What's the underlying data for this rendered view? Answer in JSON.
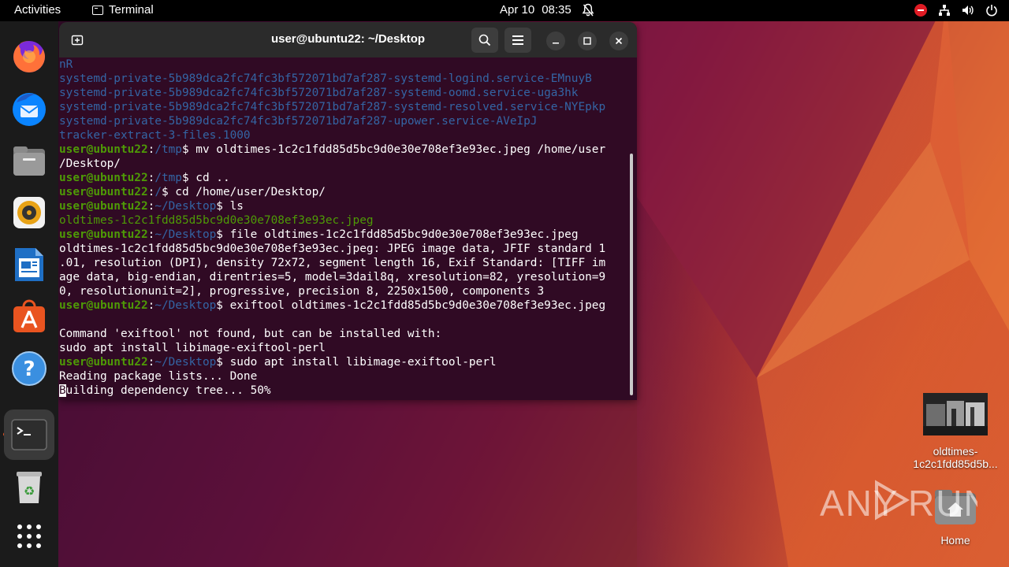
{
  "topbar": {
    "activities": "Activities",
    "app_name": "Terminal",
    "date": "Apr 10",
    "time": "08:35"
  },
  "dock": {
    "items": [
      "firefox-icon",
      "thunderbird-icon",
      "files-icon",
      "rhythmbox-icon",
      "writer-icon",
      "app-center-icon",
      "help-icon",
      "terminal-icon",
      "trash-icon",
      "show-apps-icon"
    ]
  },
  "terminal": {
    "title": "user@ubuntu22: ~/Desktop",
    "lines": [
      [
        {
          "t": "nR",
          "c": "blue"
        }
      ],
      [
        {
          "t": "systemd-private-5b989dca2fc74fc3bf572071bd7af287-systemd-logind.service-EMnuyB",
          "c": "blue"
        }
      ],
      [
        {
          "t": "systemd-private-5b989dca2fc74fc3bf572071bd7af287-systemd-oomd.service-uga3hk",
          "c": "blue"
        }
      ],
      [
        {
          "t": "systemd-private-5b989dca2fc74fc3bf572071bd7af287-systemd-resolved.service-NYEpkp",
          "c": "blue"
        }
      ],
      [
        {
          "t": "systemd-private-5b989dca2fc74fc3bf572071bd7af287-upower.service-AVeIpJ",
          "c": "blue"
        }
      ],
      [
        {
          "t": "tracker-extract-3-files.1000",
          "c": "blue"
        }
      ],
      [
        {
          "t": "user@ubuntu22",
          "c": "ugreen"
        },
        {
          "t": ":",
          "c": "w"
        },
        {
          "t": "/tmp",
          "c": "blue"
        },
        {
          "t": "$ mv oldtimes-1c2c1fdd85d5bc9d0e30e708ef3e93ec.jpeg /home/user",
          "c": "w"
        }
      ],
      [
        {
          "t": "/Desktop/",
          "c": "w"
        }
      ],
      [
        {
          "t": "user@ubuntu22",
          "c": "ugreen"
        },
        {
          "t": ":",
          "c": "w"
        },
        {
          "t": "/tmp",
          "c": "blue"
        },
        {
          "t": "$ cd ..",
          "c": "w"
        }
      ],
      [
        {
          "t": "user@ubuntu22",
          "c": "ugreen"
        },
        {
          "t": ":",
          "c": "w"
        },
        {
          "t": "/",
          "c": "blue"
        },
        {
          "t": "$ cd /home/user/Desktop/",
          "c": "w"
        }
      ],
      [
        {
          "t": "user@ubuntu22",
          "c": "ugreen"
        },
        {
          "t": ":",
          "c": "w"
        },
        {
          "t": "~/Desktop",
          "c": "blue"
        },
        {
          "t": "$ ls",
          "c": "w"
        }
      ],
      [
        {
          "t": "oldtimes-1c2c1fdd85d5bc9d0e30e708ef3e93ec.jpeg",
          "c": "green"
        }
      ],
      [
        {
          "t": "user@ubuntu22",
          "c": "ugreen"
        },
        {
          "t": ":",
          "c": "w"
        },
        {
          "t": "~/Desktop",
          "c": "blue"
        },
        {
          "t": "$ file oldtimes-1c2c1fdd85d5bc9d0e30e708ef3e93ec.jpeg",
          "c": "w"
        }
      ],
      [
        {
          "t": "oldtimes-1c2c1fdd85d5bc9d0e30e708ef3e93ec.jpeg: JPEG image data, JFIF standard 1",
          "c": "w"
        }
      ],
      [
        {
          "t": ".01, resolution (DPI), density 72x72, segment length 16, Exif Standard: [TIFF im",
          "c": "w"
        }
      ],
      [
        {
          "t": "age data, big-endian, direntries=5, model=3dail8q, xresolution=82, yresolution=9",
          "c": "w"
        }
      ],
      [
        {
          "t": "0, resolutionunit=2], progressive, precision 8, 2250x1500, components 3",
          "c": "w"
        }
      ],
      [
        {
          "t": "user@ubuntu22",
          "c": "ugreen"
        },
        {
          "t": ":",
          "c": "w"
        },
        {
          "t": "~/Desktop",
          "c": "blue"
        },
        {
          "t": "$ exiftool oldtimes-1c2c1fdd85d5bc9d0e30e708ef3e93ec.jpeg",
          "c": "w"
        }
      ],
      [
        {
          "t": "",
          "c": "w"
        }
      ],
      [
        {
          "t": "Command 'exiftool' not found, but can be installed with:",
          "c": "w"
        }
      ],
      [
        {
          "t": "sudo apt install libimage-exiftool-perl",
          "c": "w"
        }
      ],
      [
        {
          "t": "user@ubuntu22",
          "c": "ugreen"
        },
        {
          "t": ":",
          "c": "w"
        },
        {
          "t": "~/Desktop",
          "c": "blue"
        },
        {
          "t": "$ sudo apt install libimage-exiftool-perl",
          "c": "w"
        }
      ],
      [
        {
          "t": "Reading package lists... Done",
          "c": "w"
        }
      ],
      [
        {
          "t": "B",
          "c": "cursor"
        },
        {
          "t": "uilding dependency tree... 50%",
          "c": "w"
        }
      ]
    ]
  },
  "desktop": {
    "file_icon_label_1": "oldtimes-",
    "file_icon_label_2": "1c2c1fdd85d5b...",
    "home_label": "Home",
    "watermark": "ANY RUN"
  }
}
